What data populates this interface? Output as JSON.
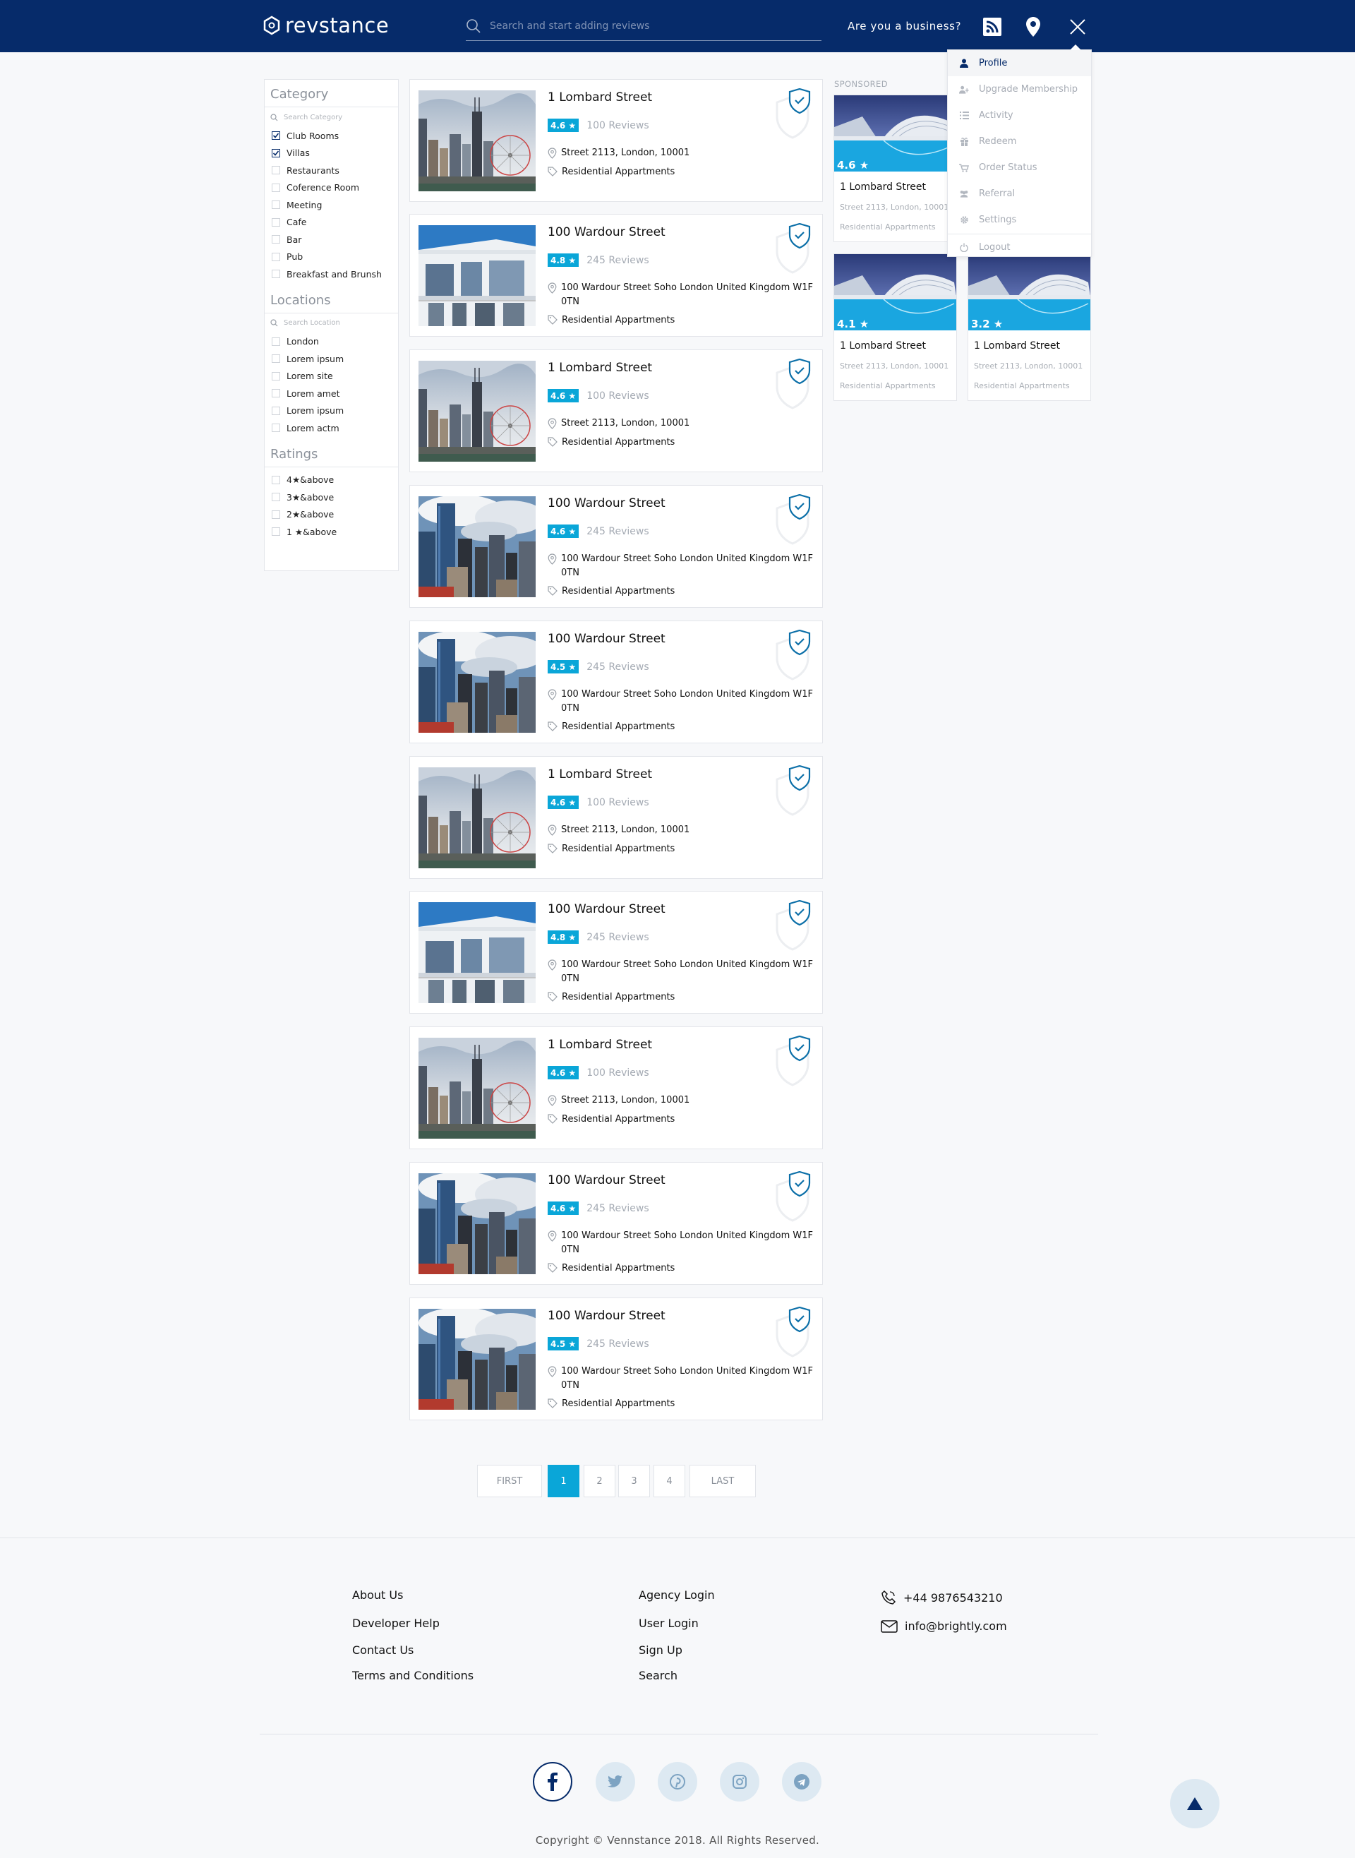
{
  "header": {
    "logo_text": "revstance",
    "search_placeholder": "Search and start adding reviews",
    "business_link": "Are you a business?",
    "icons": [
      "rss-icon",
      "location-pin-icon",
      "close-icon"
    ],
    "bg_color": "#062b6a"
  },
  "dropdown": {
    "items": [
      {
        "label": "Profile",
        "icon": "user-icon",
        "active": true
      },
      {
        "label": "Upgrade Membership",
        "icon": "user-upgrade-icon"
      },
      {
        "label": "Activity",
        "icon": "list-icon"
      },
      {
        "label": "Redeem",
        "icon": "gift-icon"
      },
      {
        "label": "Order Status",
        "icon": "cart-icon"
      },
      {
        "label": "Referral",
        "icon": "users-icon"
      },
      {
        "label": "Settings",
        "icon": "gear-icon"
      },
      {
        "label": "Logout",
        "icon": "power-icon"
      }
    ]
  },
  "sidebar": {
    "category": {
      "title": "Category",
      "search_placeholder": "Search Category",
      "items": [
        {
          "label": "Club Rooms",
          "checked": true
        },
        {
          "label": "Villas",
          "checked": true
        },
        {
          "label": "Restaurants",
          "checked": false
        },
        {
          "label": "Coference Room",
          "checked": false
        },
        {
          "label": "Meeting",
          "checked": false
        },
        {
          "label": "Cafe",
          "checked": false
        },
        {
          "label": "Bar",
          "checked": false
        },
        {
          "label": "Pub",
          "checked": false
        },
        {
          "label": "Breakfast and Brunsh",
          "checked": false
        }
      ]
    },
    "locations": {
      "title": "Locations",
      "search_placeholder": "Search Location",
      "items": [
        "London",
        "Lorem ipsum",
        "Lorem site",
        "Lorem amet",
        "Lorem ipsum",
        "Lorem actm"
      ]
    },
    "ratings": {
      "title": "Ratings",
      "items": [
        "4★&above",
        "3★&above",
        "2★&above",
        "1 ★&above"
      ]
    }
  },
  "listings": [
    {
      "title": "1 Lombard Street",
      "rating": "4.6 ★",
      "reviews": "100 Reviews",
      "address": "Street 2113, London, 10001",
      "category": "Residential Appartments",
      "image": "ferris-skyline"
    },
    {
      "title": "100 Wardour Street",
      "rating": "4.8 ★",
      "reviews": "245 Reviews",
      "address": "100 Wardour Street Soho London United Kingdom W1F 0TN",
      "category": "Residential Appartments",
      "image": "white-villa"
    },
    {
      "title": "1 Lombard Street",
      "rating": "4.6 ★",
      "reviews": "100 Reviews",
      "address": "Street 2113, London, 10001",
      "category": "Residential Appartments",
      "image": "ferris-skyline"
    },
    {
      "title": "100 Wardour Street",
      "rating": "4.6 ★",
      "reviews": "245 Reviews",
      "address": "100 Wardour Street Soho London United Kingdom W1F 0TN",
      "category": "Residential Appartments",
      "image": "cloudy-towers"
    },
    {
      "title": "100 Wardour Street",
      "rating": "4.5 ★",
      "reviews": "245 Reviews",
      "address": "100 Wardour Street Soho London United Kingdom W1F 0TN",
      "category": "Residential Appartments",
      "image": "cloudy-towers"
    },
    {
      "title": "1 Lombard Street",
      "rating": "4.6 ★",
      "reviews": "100 Reviews",
      "address": "Street 2113, London, 10001",
      "category": "Residential Appartments",
      "image": "ferris-skyline"
    },
    {
      "title": "100 Wardour Street",
      "rating": "4.8 ★",
      "reviews": "245 Reviews",
      "address": "100 Wardour Street Soho London United Kingdom W1F 0TN",
      "category": "Residential Appartments",
      "image": "white-villa"
    },
    {
      "title": "1 Lombard Street",
      "rating": "4.6 ★",
      "reviews": "100 Reviews",
      "address": "Street 2113, London, 10001",
      "category": "Residential Appartments",
      "image": "ferris-skyline"
    },
    {
      "title": "100 Wardour Street",
      "rating": "4.6 ★",
      "reviews": "245 Reviews",
      "address": "100 Wardour Street Soho London United Kingdom W1F 0TN",
      "category": "Residential Appartments",
      "image": "cloudy-towers"
    },
    {
      "title": "100 Wardour Street",
      "rating": "4.5 ★",
      "reviews": "245 Reviews",
      "address": "100 Wardour Street Soho London United Kingdom W1F 0TN",
      "category": "Residential Appartments",
      "image": "cloudy-towers"
    }
  ],
  "sponsored": {
    "label": "SPONSORED",
    "cards": [
      {
        "rating": "4.6 ★",
        "title": "1 Lombard Street",
        "address": "Street 2113, London, 10001",
        "category": "Residential Appartments"
      },
      {
        "rating": "4.1 ★",
        "title": "1 Lombard Street",
        "address": "Street 2113, London, 10001",
        "category": "Residential Appartments"
      },
      {
        "rating": "3.2 ★",
        "title": "1 Lombard Street",
        "address": "Street 2113, London, 10001",
        "category": "Residential Appartments"
      }
    ]
  },
  "pagination": {
    "first": "FIRST",
    "pages": [
      "1",
      "2",
      "3",
      "4"
    ],
    "current": "1",
    "last": "LAST"
  },
  "footer": {
    "col1": [
      "About Us",
      "Developer Help",
      "Contact Us",
      "Terms and Conditions"
    ],
    "col2": [
      "Agency Login",
      "User Login",
      "Sign Up",
      "Search"
    ],
    "phone": "+44 9876543210",
    "email": "info@brightly.com",
    "social": [
      "facebook-icon",
      "twitter-icon",
      "pinterest-icon",
      "instagram-icon",
      "telegram-icon"
    ],
    "copyright": "Copyright © Vennstance 2018. All Rights Reserved."
  },
  "colors": {
    "accent": "#0aa6d8",
    "brand": "#062b6a"
  }
}
